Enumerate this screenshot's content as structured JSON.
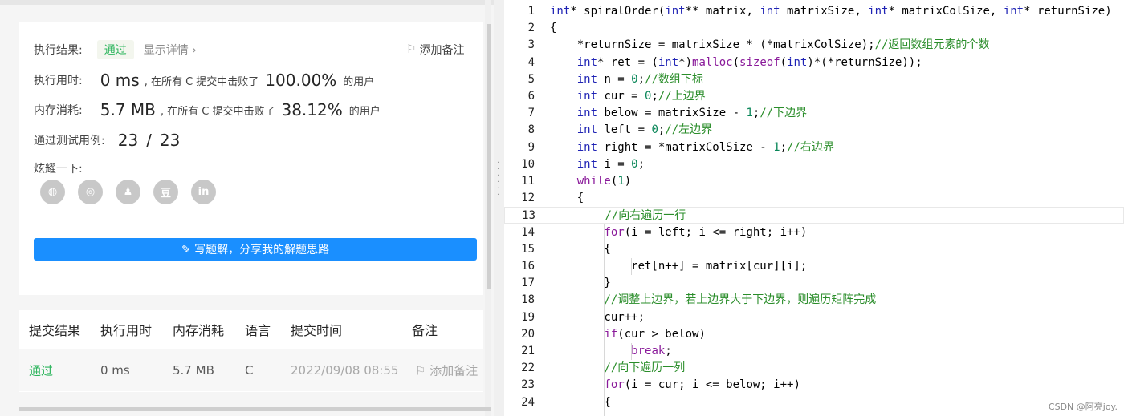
{
  "result": {
    "label": "执行结果:",
    "status": "通过",
    "detail_link": "显示详情 ›",
    "add_note": "添加备注",
    "runtime_label": "执行用时:",
    "runtime_value": "0 ms",
    "runtime_mid": ", 在所有 C 提交中击败了",
    "runtime_pct": "100.00%",
    "runtime_suffix": "的用户",
    "memory_label": "内存消耗:",
    "memory_value": "5.7 MB",
    "memory_mid": ", 在所有 C 提交中击败了",
    "memory_pct": "38.12%",
    "memory_suffix": "的用户",
    "cases_label": "通过测试用例:",
    "cases_passed": "23",
    "cases_sep": "/",
    "cases_total": "23",
    "share_label": "炫耀一下:",
    "share_icons": [
      "wechat-icon",
      "weibo-icon",
      "qq-icon",
      "douban-icon",
      "linkedin-icon"
    ],
    "share_glyphs": [
      "◍",
      "◎",
      "♟",
      "豆",
      "in"
    ],
    "write_button": "✎ 写题解，分享我的解题思路"
  },
  "table": {
    "headers": [
      "提交结果",
      "执行用时",
      "内存消耗",
      "语言",
      "提交时间",
      "备注"
    ],
    "row": {
      "status": "通过",
      "runtime": "0 ms",
      "memory": "5.7 MB",
      "language": "C",
      "time": "2022/09/08 08:55",
      "note": "添加备注"
    }
  },
  "colors": {
    "accent": "#1a8fff",
    "success": "#2db55d",
    "keyword": "#1e22b4",
    "control": "#8a1a9a",
    "comment": "#2a8d2a"
  },
  "code_lines": [
    {
      "n": "1",
      "t": "int* spiralOrder(int** matrix, int matrixSize, int* matrixColSize, int* returnSize)"
    },
    {
      "n": "2",
      "t": "{"
    },
    {
      "n": "3",
      "t": "    *returnSize = matrixSize * (*matrixColSize);//返回数组元素的个数"
    },
    {
      "n": "4",
      "t": "    int* ret = (int*)malloc(sizeof(int)*(*returnSize));"
    },
    {
      "n": "5",
      "t": "    int n = 0;//数组下标"
    },
    {
      "n": "6",
      "t": "    int cur = 0;//上边界"
    },
    {
      "n": "7",
      "t": "    int below = matrixSize - 1;//下边界"
    },
    {
      "n": "8",
      "t": "    int left = 0;//左边界"
    },
    {
      "n": "9",
      "t": "    int right = *matrixColSize - 1;//右边界"
    },
    {
      "n": "10",
      "t": "    int i = 0;"
    },
    {
      "n": "11",
      "t": "    while(1)"
    },
    {
      "n": "12",
      "t": "    {"
    },
    {
      "n": "13",
      "t": "        //向右遍历一行"
    },
    {
      "n": "14",
      "t": "        for(i = left; i <= right; i++)"
    },
    {
      "n": "15",
      "t": "        {"
    },
    {
      "n": "16",
      "t": "            ret[n++] = matrix[cur][i];"
    },
    {
      "n": "17",
      "t": "        }"
    },
    {
      "n": "18",
      "t": "        //调整上边界，若上边界大于下边界，则遍历矩阵完成"
    },
    {
      "n": "19",
      "t": "        cur++;"
    },
    {
      "n": "20",
      "t": "        if(cur > below)"
    },
    {
      "n": "21",
      "t": "            break;"
    },
    {
      "n": "22",
      "t": "        //向下遍历一列"
    },
    {
      "n": "23",
      "t": "        for(i = cur; i <= below; i++)"
    },
    {
      "n": "24",
      "t": "        {"
    }
  ],
  "watermark": "CSDN @阿亮joy."
}
